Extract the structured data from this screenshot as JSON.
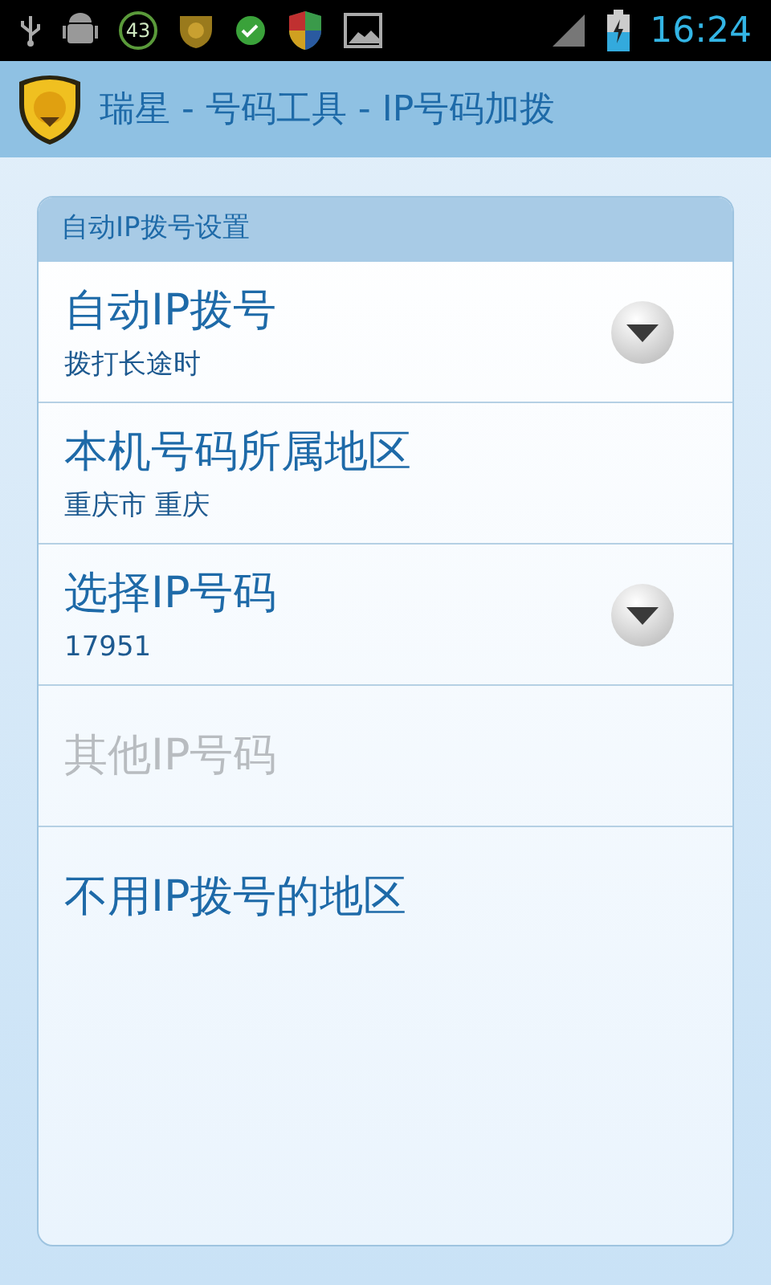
{
  "status_bar": {
    "badge": "43",
    "time": "16:24"
  },
  "title_bar": {
    "title": "瑞星 - 号码工具 - IP号码加拨"
  },
  "section": {
    "header": "自动IP拨号设置",
    "items": [
      {
        "kind": "dropdown",
        "title": "自动IP拨号",
        "summary": "拨打长途时",
        "disabled": false
      },
      {
        "kind": "plain",
        "title": "本机号码所属地区",
        "summary": "重庆市 重庆",
        "disabled": false
      },
      {
        "kind": "dropdown",
        "title": "选择IP号码",
        "summary": "17951",
        "disabled": false
      },
      {
        "kind": "plain",
        "title": "其他IP号码",
        "disabled": true
      },
      {
        "kind": "plain",
        "title": "不用IP拨号的地区",
        "disabled": false
      }
    ]
  }
}
